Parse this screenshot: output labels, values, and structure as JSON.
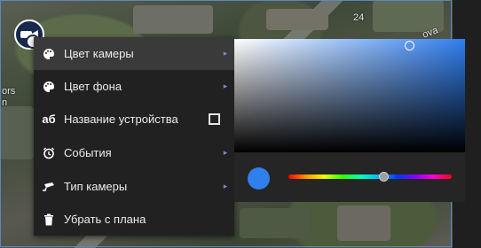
{
  "map": {
    "labels": {
      "house_number": "24",
      "street_part": "ova",
      "left_part_1": "ors",
      "left_part_2": "n"
    }
  },
  "device_marker": {
    "icon": "camera-marker-icon"
  },
  "context_menu": {
    "items": [
      {
        "label": "Цвет камеры",
        "icon": "palette-icon",
        "has_submenu": true,
        "active": true
      },
      {
        "label": "Цвет фона",
        "icon": "palette-icon",
        "has_submenu": true,
        "active": false
      },
      {
        "label": "Название устройства",
        "icon": "text-format-icon",
        "icon_text": "аб",
        "checkbox": true,
        "checked": false
      },
      {
        "label": "События",
        "icon": "alarm-clock-icon",
        "has_submenu": true,
        "active": false
      },
      {
        "label": "Тип камеры",
        "icon": "camera-icon",
        "has_submenu": true,
        "active": false
      },
      {
        "label": "Убрать с плана",
        "icon": "trash-icon",
        "has_submenu": false,
        "active": false
      }
    ],
    "submenu_arrow": "▸"
  },
  "color_picker": {
    "selected_color": "#2f80ed",
    "hue_color": "#2f7ef0"
  },
  "colors": {
    "menu_bg": "#212121",
    "menu_active_bg": "#3a3a3a",
    "accent": "#6f8dc8"
  }
}
